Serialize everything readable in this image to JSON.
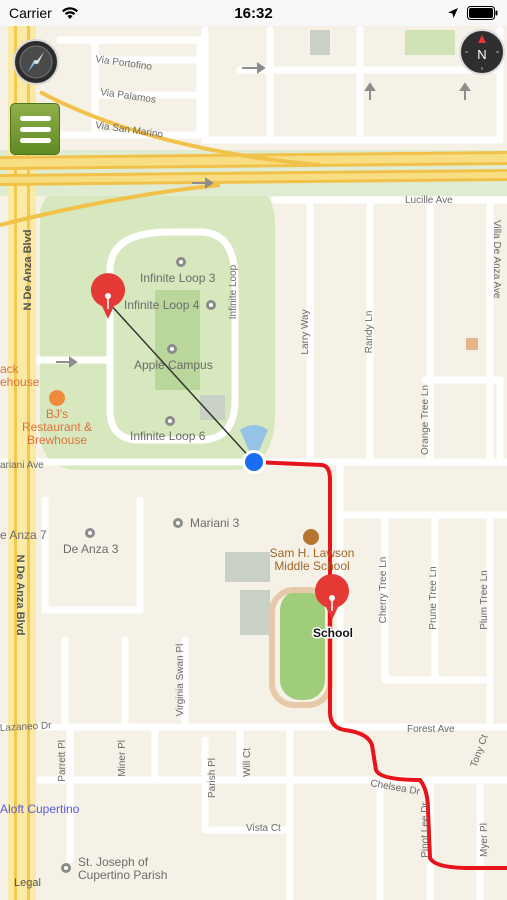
{
  "status_bar": {
    "carrier": "Carrier",
    "time": "16:32"
  },
  "map": {
    "streets": {
      "via_portofino": "Via Portofino",
      "via_palamos": "Via Palamos",
      "via_san_marino": "Via San Marino",
      "lucille_ave": "Lucille Ave",
      "villa_de_anza": "Villa De Anza Ave",
      "n_de_anza_top": "N De Anza Blvd",
      "n_de_anza_bottom": "N De Anza Blvd",
      "infinite_loop": "Infinite Loop",
      "larry_way": "Larry Way",
      "randy_ln": "Randy Ln",
      "orange_tree": "Orange Tree Ln",
      "mariani_ave": "ariani Ave",
      "cherry_tree": "Cherry Tree Ln",
      "prune_tree": "Prune Tree Ln",
      "plum_tree": "Plum Tree Ln",
      "virginia_swan": "Virginia Swan Pl",
      "forest_ave": "Forest Ave",
      "lazaneo": "Lazaneo Dr",
      "parrett": "Parrett Pl",
      "miner": "Miner Pl",
      "parish": "Parish Pl",
      "will_ct": "Will Ct",
      "vista_ct": "Vista Ct",
      "chelsea": "Chelsea Dr",
      "myer": "Myer Pl",
      "tony": "Tony Ct",
      "pinot_lee": "Pinot Lee Dr",
      "legal": "Legal"
    },
    "places": {
      "loop3": "Infinite Loop 3",
      "loop4": "Infinite Loop 4",
      "apple_campus": "Apple Campus",
      "loop6": "Infinite Loop 6",
      "bjs_line1": "BJ's",
      "bjs_line2": "Restaurant &",
      "bjs_line3": "Brewhouse",
      "mariani3": "Mariani 3",
      "deanza3": "De Anza 3",
      "deanza7": "e Anza 7",
      "lawson_line1": "Sam H. Lawson",
      "lawson_line2": "Middle School",
      "aloft": "Aloft Cupertino",
      "st_joseph_line1": "St. Joseph of",
      "st_joseph_line2": "Cupertino Parish",
      "jack_line1": "ack",
      "jack_line2": "ehouse"
    },
    "pins": {
      "school": "School"
    },
    "compass_letter": "N",
    "colors": {
      "route": "#e8141c",
      "user_location": "#1a6cf0",
      "pin": "#e53935",
      "highway": "#f5cc4a"
    }
  },
  "controls": {
    "compass_icon": "compass-icon",
    "menu_icon": "list-menu-icon"
  }
}
